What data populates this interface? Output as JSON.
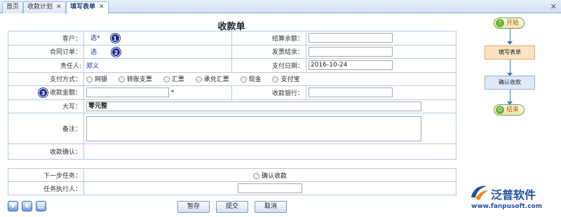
{
  "tabs": [
    {
      "label": "首页",
      "closable": false
    },
    {
      "label": "收款计划",
      "closable": true
    },
    {
      "label": "填写表单",
      "closable": true
    }
  ],
  "window_close": "✕",
  "form": {
    "title": "收款单",
    "customer_label": "客户：",
    "customer_value": "选*",
    "settle_balance_label": "结算余额：",
    "settle_balance_value": "",
    "order_label": "合同订单：",
    "order_value": "选",
    "invoice_balance_label": "发票结余：",
    "invoice_balance_value": "",
    "owner_label": "责任人:",
    "owner_value": "郑义",
    "pay_date_label": "支付日期：",
    "pay_date_value": "2016-10-24",
    "pay_method_label": "支付方式：",
    "pay_methods": [
      "网银",
      "转账支票",
      "汇票",
      "承兑汇票",
      "现金",
      "支付宝"
    ],
    "amount_label": "收款金额：",
    "amount_value": "",
    "required_mark": "*",
    "bank_label": "收款银行：",
    "bank_value": "",
    "uppercase_label": "大写：",
    "uppercase_value": "零元整",
    "remark_label": "备注：",
    "remark_value": "",
    "confirm_label": "收款确认：",
    "next_task_label": "下一步任务：",
    "next_task_option": "确认收款",
    "executor_label": "任务执行人：",
    "executor_value": ""
  },
  "markers": [
    "1",
    "2",
    "3"
  ],
  "buttons": {
    "save": "暂存",
    "submit": "提交",
    "cancel": "取消"
  },
  "bottom_icons": [
    "heart-icon",
    "star-icon",
    "print-icon"
  ],
  "flow": {
    "start": "开始",
    "step1": "填写表单",
    "step2": "确认收款",
    "end": "结束",
    "start_glyph": "!",
    "end_glyph": "O"
  },
  "logo": {
    "name": "泛普软件",
    "url": "www.fanpusoft.com"
  },
  "colors": {
    "accent": "#1f4fa0",
    "active_step_bg": "#fbe2c3",
    "step_bg": "#dde9f7",
    "marker": "#1a2c8c"
  }
}
